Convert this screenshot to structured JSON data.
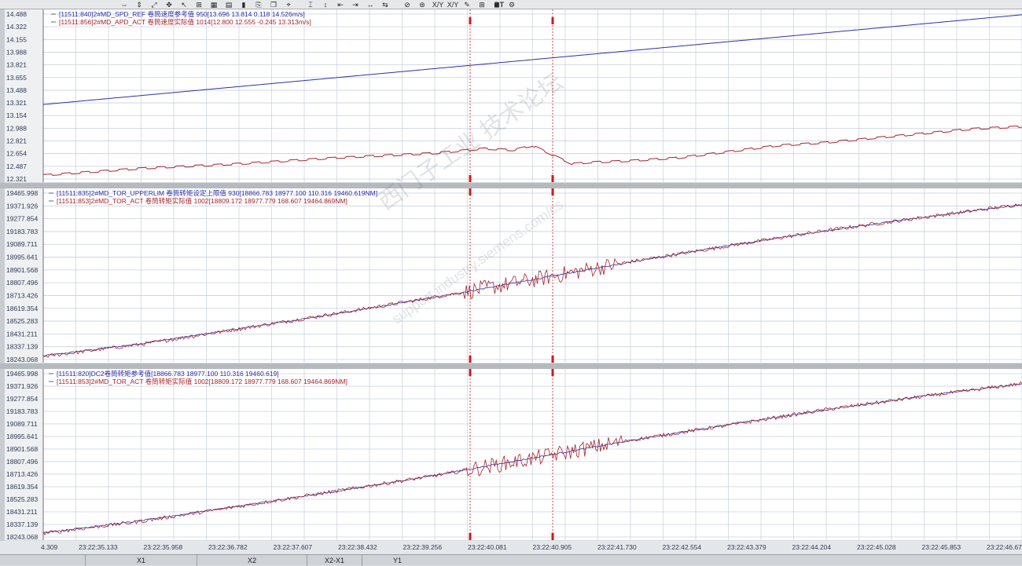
{
  "toolbar": {
    "icons": [
      "zoom-x-icon",
      "zoom-y-icon",
      "zoom-xy-icon",
      "pan-icon",
      "cursor-icon",
      "measure-icon",
      "table-icon",
      "grid-icon",
      "bar-icon",
      "export-icon",
      "copy-icon",
      "marker-icon",
      "cursor-x-icon",
      "cursor-y-icon",
      "step-left-icon",
      "step-right-icon",
      "expand-icon",
      "compress-icon",
      "stop-icon",
      "record-icon",
      "xy-icon",
      "xy-swap-icon",
      "color-icon",
      "layout-icon",
      "3d-icon",
      "settings-icon"
    ],
    "labels": {
      "xy1": "X/Y",
      "xy2": "X/Y",
      "rt": "RT"
    }
  },
  "colors": {
    "blue_signal": "#2b2fa8",
    "red_signal": "#a8222a",
    "cursor": "#d01818",
    "grid": "#c8d0dc",
    "background": "#ffffff"
  },
  "chart_data": [
    {
      "type": "line",
      "yticks": [
        "14.488",
        "14.322",
        "14.155",
        "13.988",
        "13.821",
        "13.655",
        "13.488",
        "13.321",
        "13.154",
        "12.988",
        "12.821",
        "12.654",
        "12.487",
        "12.321"
      ],
      "ylim": [
        12.321,
        14.488
      ],
      "legend": [
        {
          "text": "[11511:840]2#MD_SPD_REF 卷筒速度参考值 950[13.696  13.814  0.118  14.526m/s]",
          "color": "#2b2fa8"
        },
        {
          "text": "[11511:856]2#MD_APD_ACT 卷筒速度实际值 1014[12.800  12.555  -0.245  13.313m/s]",
          "color": "#a8222a"
        }
      ],
      "series": [
        {
          "name": "2#MD_SPD_REF",
          "color": "#2b2fa8",
          "x": [
            0,
            1
          ],
          "y": [
            13.3,
            14.48
          ]
        },
        {
          "name": "2#MD_APD_ACT",
          "color": "#a8222a",
          "x": [
            0,
            0.1,
            0.2,
            0.3,
            0.35,
            0.4,
            0.45,
            0.48,
            0.5,
            0.52,
            0.54,
            0.56,
            0.58,
            0.6,
            0.65,
            0.7,
            0.75,
            0.8,
            0.85,
            0.9,
            0.95,
            1
          ],
          "y": [
            12.37,
            12.46,
            12.52,
            12.6,
            12.63,
            12.66,
            12.72,
            12.7,
            12.76,
            12.64,
            12.52,
            12.54,
            12.55,
            12.56,
            12.6,
            12.68,
            12.76,
            12.8,
            12.86,
            12.92,
            12.98,
            13.01
          ]
        }
      ]
    },
    {
      "type": "line",
      "yticks": [
        "19465.998",
        "19371.926",
        "19277.854",
        "19183.783",
        "19089.711",
        "18995.641",
        "18901.568",
        "18807.496",
        "18713.426",
        "18619.354",
        "18525.283",
        "18431.211",
        "18337.139",
        "18243.068"
      ],
      "ylim": [
        18243.068,
        19465.998
      ],
      "legend": [
        {
          "text": "[11511:835]2#MD_TOR_UPPERLIM 卷筒转矩设定上限值  930[18866.783  18977.100  110.316  19460.619NM]",
          "color": "#2b2fa8"
        },
        {
          "text": "[11511:853]2#MD_TOR_ACT 卷筒转矩实际值  1002[18809.172  18977.779  168.607  19464.869NM]",
          "color": "#a8222a"
        }
      ],
      "series": [
        {
          "name": "2#MD_TOR_UPPERLIM",
          "color": "#2b2fa8",
          "x": [
            0,
            0.1,
            0.2,
            0.3,
            0.4,
            0.5,
            0.6,
            0.7,
            0.8,
            0.9,
            1
          ],
          "y": [
            18270,
            18360,
            18470,
            18580,
            18700,
            18830,
            18960,
            19080,
            19190,
            19290,
            19380
          ]
        },
        {
          "name": "2#MD_TOR_ACT",
          "color": "#a8222a",
          "x": [
            0,
            0.1,
            0.2,
            0.3,
            0.4,
            0.5,
            0.6,
            0.7,
            0.8,
            0.9,
            1
          ],
          "y": [
            18265,
            18355,
            18468,
            18582,
            18702,
            18828,
            18962,
            19078,
            19192,
            19288,
            19385
          ]
        }
      ]
    },
    {
      "type": "line",
      "yticks": [
        "19465.998",
        "19371.926",
        "19277.854",
        "19183.783",
        "19089.711",
        "18995.641",
        "18901.568",
        "18807.496",
        "18713.426",
        "18619.354",
        "18525.283",
        "18431.211",
        "18337.139",
        "18243.068"
      ],
      "ylim": [
        18243.068,
        19465.998
      ],
      "legend": [
        {
          "text": "[11511:820]DC2卷筒转矩参考值[18866.783  18977.100  110.316  19460.619]",
          "color": "#2b2fa8"
        },
        {
          "text": "[11511:853]2#MD_TOR_ACT 卷筒转矩实际值  1002[18809.172  18977.779  168.607  19464.869NM]",
          "color": "#a8222a"
        }
      ],
      "series": [
        {
          "name": "DC2卷筒转矩参考值",
          "color": "#2b2fa8",
          "x": [
            0,
            0.1,
            0.2,
            0.3,
            0.4,
            0.5,
            0.6,
            0.7,
            0.8,
            0.9,
            1
          ],
          "y": [
            18275,
            18365,
            18475,
            18585,
            18705,
            18835,
            18965,
            19085,
            19195,
            19300,
            19390
          ]
        },
        {
          "name": "2#MD_TOR_ACT",
          "color": "#a8222a",
          "x": [
            0,
            0.1,
            0.2,
            0.3,
            0.4,
            0.5,
            0.6,
            0.7,
            0.8,
            0.9,
            1
          ],
          "y": [
            18270,
            18360,
            18472,
            18588,
            18702,
            18830,
            18968,
            19080,
            19198,
            19296,
            19392
          ]
        }
      ]
    }
  ],
  "xaxis": {
    "ticks": [
      "4.309",
      "23:22:35.133",
      "23:22:35.958",
      "23:22:36.782",
      "23:22:37.607",
      "23:22:38.432",
      "23:22:39.256",
      "23:22:40.081",
      "23:22:40.905",
      "23:22:41.730",
      "23:22:42.554",
      "23:22:43.379",
      "23:22:44.204",
      "23:22:45.028",
      "23:22:45.853",
      "23:22:46.677"
    ]
  },
  "cursors": {
    "a": "23:22:40.081",
    "b": "23:22:40.905"
  },
  "bottombar": {
    "cells": [
      "X1",
      "X2",
      "X2-X1",
      "Y1"
    ]
  },
  "watermark": {
    "line1": "西门子工业 技术论坛",
    "line2": "support.industry.siemens.com/cs"
  }
}
